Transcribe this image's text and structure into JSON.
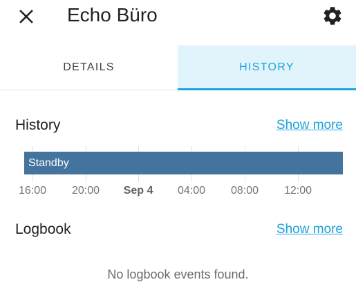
{
  "header": {
    "title": "Echo Büro"
  },
  "tabs": {
    "details": "DETAILS",
    "history": "HISTORY"
  },
  "history": {
    "title": "History",
    "show_more": "Show more",
    "bar": {
      "label": "Standby",
      "color": "#44739e"
    },
    "axis_labels": [
      "16:00",
      "20:00",
      "Sep 4",
      "04:00",
      "08:00",
      "12:00"
    ]
  },
  "logbook": {
    "title": "Logbook",
    "show_more": "Show more",
    "empty_message": "No logbook events found."
  },
  "colors": {
    "accent": "#1aa3dd",
    "tab_active_bg": "#e1f4fb",
    "text": "#212121"
  }
}
